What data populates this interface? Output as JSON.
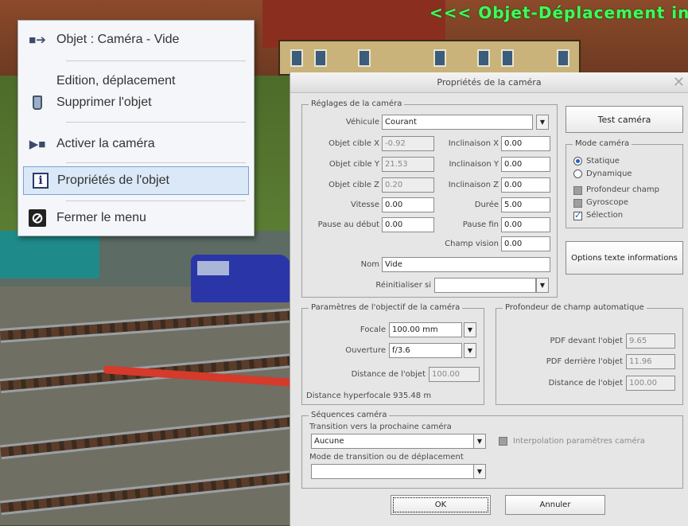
{
  "scene": {
    "banner": "<<< Objet-Déplacement in d"
  },
  "context_menu": {
    "items": [
      {
        "label": "Objet : Caméra - Vide",
        "icon": "camera-arrow-icon"
      },
      {
        "label": "Edition, déplacement",
        "icon": "none"
      },
      {
        "label": "Supprimer l'objet",
        "icon": "trash-icon"
      },
      {
        "label": "Activer la caméra",
        "icon": "camera-icon"
      },
      {
        "label": "Propriétés de l'objet",
        "icon": "info-icon"
      },
      {
        "label": "Fermer le menu",
        "icon": "no-entry-icon"
      }
    ]
  },
  "dialog": {
    "title": "Propriétés de la caméra",
    "close_glyph": "✕",
    "camera_settings": {
      "group_title": "Réglages de la caméra",
      "vehicle_label": "Véhicule",
      "vehicle_value": "Courant",
      "target_x_label": "Objet cible X",
      "target_x_value": "-0.92",
      "target_y_label": "Objet cible Y",
      "target_y_value": "21.53",
      "target_z_label": "Objet cible Z",
      "target_z_value": "0.20",
      "tilt_x_label": "Inclinaison X",
      "tilt_x_value": "0.00",
      "tilt_y_label": "Inclinaison Y",
      "tilt_y_value": "0.00",
      "tilt_z_label": "Inclinaison Z",
      "tilt_z_value": "0.00",
      "speed_label": "Vitesse",
      "speed_value": "0.00",
      "duration_label": "Durée",
      "duration_value": "5.00",
      "pause_start_label": "Pause au début",
      "pause_start_value": "0.00",
      "pause_end_label": "Pause fin",
      "pause_end_value": "0.00",
      "fov_label": "Champ vision",
      "fov_value": "0.00",
      "name_label": "Nom",
      "name_value": "Vide",
      "reset_label": "Réinitialiser si",
      "reset_value": ""
    },
    "test_button": "Test caméra",
    "camera_mode": {
      "group_title": "Mode caméra",
      "static": "Statique",
      "dynamic": "Dynamique",
      "depth": "Profondeur champ",
      "gyro": "Gyroscope",
      "selection": "Sélection"
    },
    "info_options_button": "Options texte informations",
    "lens": {
      "group_title": "Paramètres de l'objectif de la caméra",
      "focal_label": "Focale",
      "focal_value": "100.00 mm",
      "aperture_label": "Ouverture",
      "aperture_value": "f/3.6",
      "distance_label": "Distance de l'objet",
      "distance_value": "100.00",
      "hyperfocal": "Distance hyperfocale 935.48 m"
    },
    "auto_dof": {
      "group_title": "Profondeur de champ automatique",
      "front_label": "PDF devant l'objet",
      "front_value": "9.65",
      "behind_label": "PDF derrière l'objet",
      "behind_value": "11.96",
      "distance_label": "Distance de l'objet",
      "distance_value": "100.00"
    },
    "sequences": {
      "group_title": "Séquences caméra",
      "transition_label": "Transition vers la prochaine caméra",
      "transition_value": "Aucune",
      "mode_label": "Mode de transition ou de déplacement",
      "mode_value": "",
      "interp_label": "Interpolation paramètres caméra"
    },
    "ok_button": "OK",
    "cancel_button": "Annuler"
  }
}
